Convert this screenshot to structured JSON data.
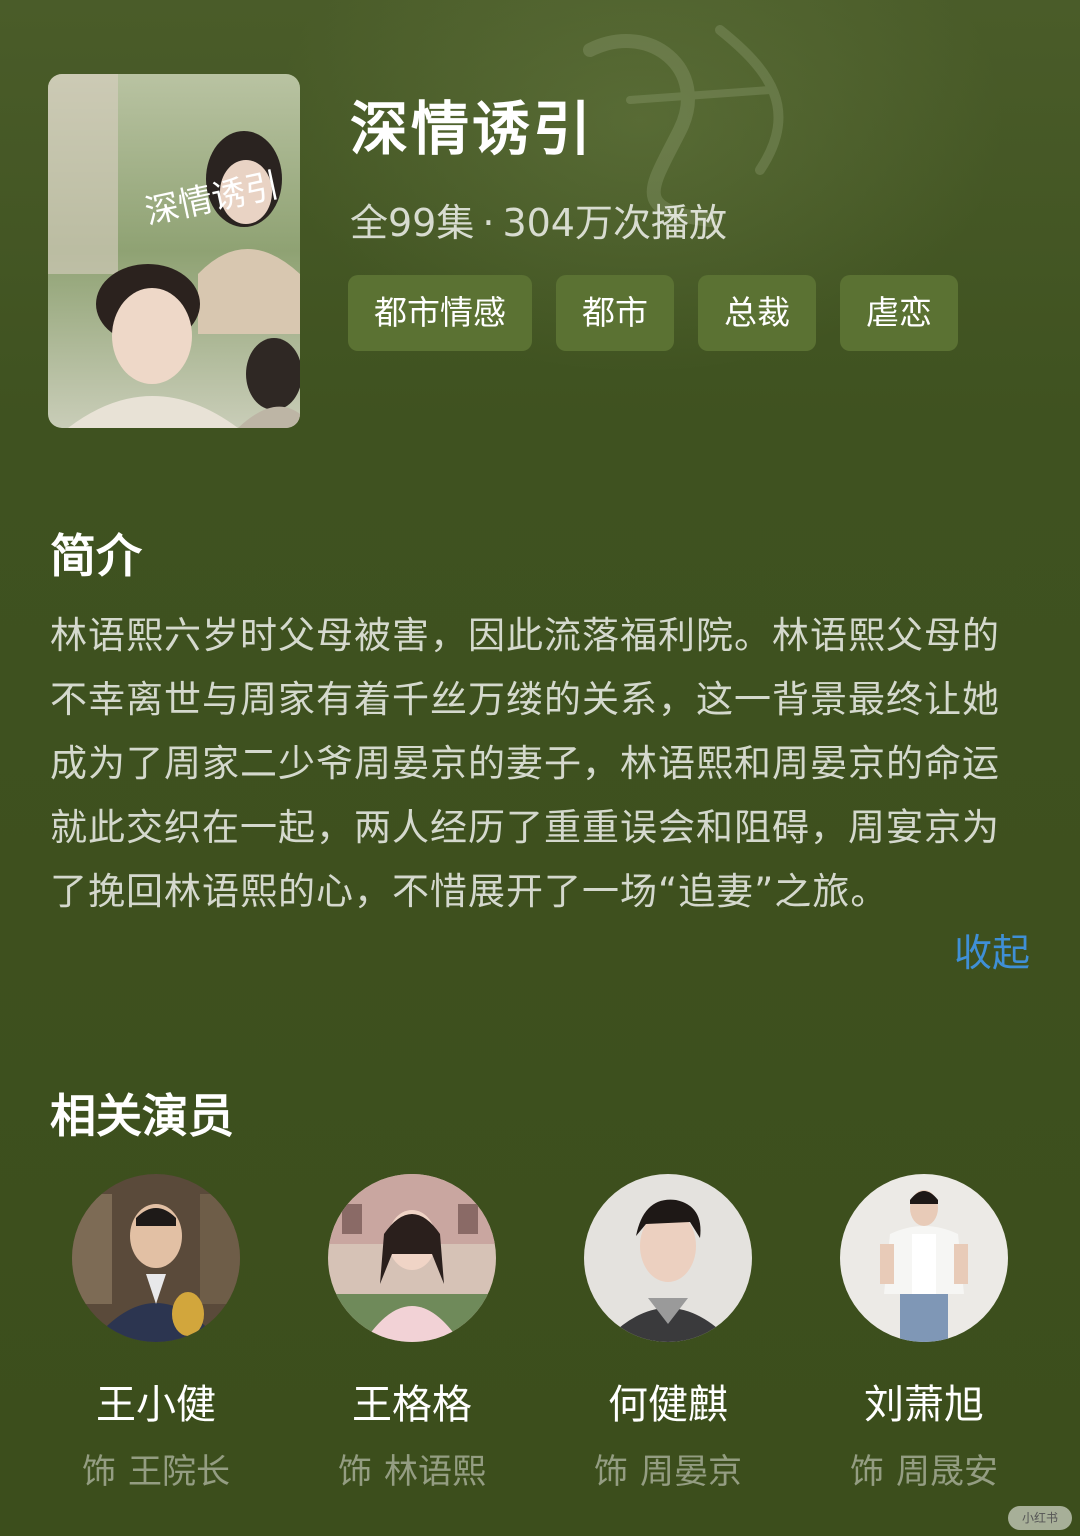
{
  "show": {
    "title": "深情诱引",
    "episodes": "全99集",
    "separator": "·",
    "plays": "304万次播放",
    "poster_calligraphy": "深情诱引",
    "tags": [
      "都市情感",
      "都市",
      "总裁",
      "虐恋"
    ]
  },
  "synopsis": {
    "heading": "简介",
    "text": "林语熙六岁时父母被害，因此流落福利院。林语熙父母的不幸离世与周家有着千丝万缕的关系，这一背景最终让她成为了周家二少爷周晏京的妻子，林语熙和周晏京的命运就此交织在一起，两人经历了重重误会和阻碍，周宴京为了挽回林语熙的心，不惜展开了一场“追妻”之旅。",
    "collapse_label": "收起"
  },
  "cast": {
    "heading": "相关演员",
    "role_prefix": "饰",
    "members": [
      {
        "name": "王小健",
        "role": "王院长"
      },
      {
        "name": "王格格",
        "role": "林语熙"
      },
      {
        "name": "何健麒",
        "role": "周晏京"
      },
      {
        "name": "刘萧旭",
        "role": "周晟安"
      }
    ]
  },
  "watermark": "小红书",
  "colors": {
    "background": "#3d4f1d",
    "tag_background": "#5b7233",
    "link": "#3f8fd6"
  },
  "icons": {
    "poster": "drama-poster-image",
    "avatars": [
      "actor-photo",
      "actor-photo",
      "actor-photo",
      "actor-photo"
    ]
  }
}
